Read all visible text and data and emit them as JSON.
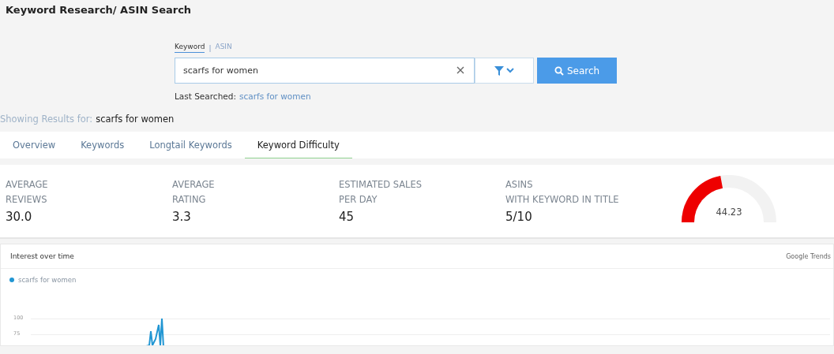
{
  "page": {
    "title": "Keyword Research/ ASIN Search"
  },
  "search_mode": [
    {
      "label": "Keyword",
      "selected": true
    },
    {
      "label": "ASIN",
      "selected": false
    }
  ],
  "mode_separator": "|",
  "search": {
    "value": "scarfs for women",
    "button": "Search"
  },
  "last_searched": {
    "label": "Last Searched:",
    "link": "scarfs for women"
  },
  "results_for": {
    "label": "Showing Results for:",
    "query": "scarfs for women"
  },
  "tabs": [
    {
      "label": "Overview",
      "selected": false
    },
    {
      "label": "Keywords",
      "selected": false
    },
    {
      "label": "Longtail Keywords",
      "selected": false
    },
    {
      "label": "Keyword Difficulty",
      "selected": true
    }
  ],
  "stats": [
    {
      "label_lines": [
        "AVERAGE",
        "REVIEWS"
      ],
      "value": "30.0"
    },
    {
      "label_lines": [
        "AVERAGE",
        "RATING"
      ],
      "value": "3.3"
    },
    {
      "label_lines": [
        "ESTIMATED SALES",
        "PER DAY"
      ],
      "value": "45"
    },
    {
      "label_lines": [
        "ASINS",
        "WITH KEYWORD IN TITLE"
      ],
      "value": "5/10"
    }
  ],
  "difficulty_gauge": {
    "level": 0.4423,
    "reading": "44.23"
  },
  "trends": {
    "title": "Interest over time",
    "source": "Google Trends",
    "legend": [
      {
        "label": "scarfs for women",
        "color": "#2196d3"
      }
    ],
    "y_tick_labels": [
      "100",
      "75"
    ]
  }
}
